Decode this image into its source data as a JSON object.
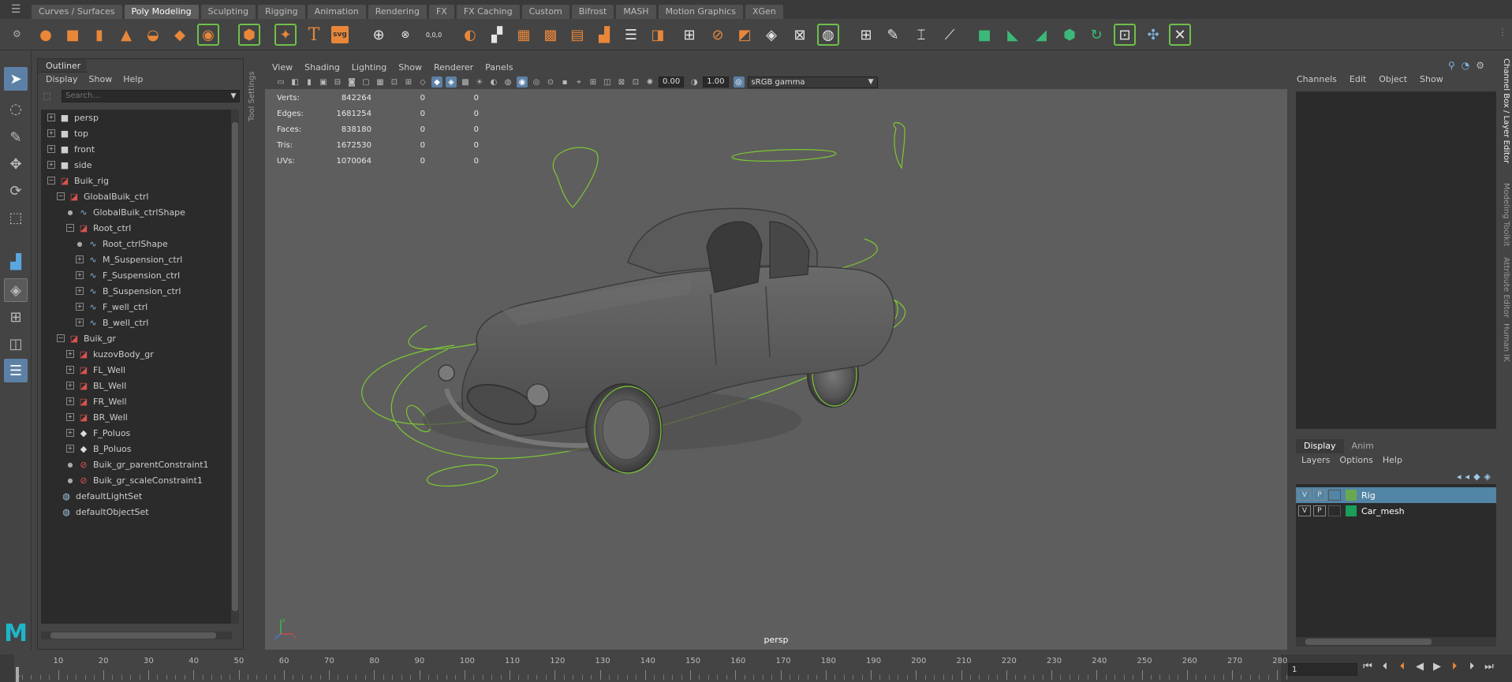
{
  "shelf": {
    "tabs": [
      "Curves / Surfaces",
      "Poly Modeling",
      "Sculpting",
      "Rigging",
      "Animation",
      "Rendering",
      "FX",
      "FX Caching",
      "Custom",
      "Bifrost",
      "MASH",
      "Motion Graphics",
      "XGen"
    ],
    "active_tab": "Poly Modeling",
    "svg_icon_label": "svg",
    "text_icon_label": "T",
    "coord_icon_label": "0,0,0"
  },
  "outliner": {
    "title": "Outliner",
    "menu": [
      "Display",
      "Show",
      "Help"
    ],
    "search_placeholder": "Search...",
    "items": [
      {
        "label": "persp",
        "icon": "camera-icon"
      },
      {
        "label": "top",
        "icon": "camera-icon"
      },
      {
        "label": "front",
        "icon": "camera-icon"
      },
      {
        "label": "side",
        "icon": "camera-icon"
      },
      {
        "label": "Buik_rig",
        "icon": "group-icon"
      },
      {
        "label": "GlobalBuik_ctrl",
        "icon": "group-icon"
      },
      {
        "label": "GlobalBuik_ctrlShape",
        "icon": "curve-icon"
      },
      {
        "label": "Root_ctrl",
        "icon": "group-icon"
      },
      {
        "label": "Root_ctrlShape",
        "icon": "curve-icon"
      },
      {
        "label": "M_Suspension_ctrl",
        "icon": "curve-icon"
      },
      {
        "label": "F_Suspension_ctrl",
        "icon": "curve-icon"
      },
      {
        "label": "B_Suspension_ctrl",
        "icon": "curve-icon"
      },
      {
        "label": "F_well_ctrl",
        "icon": "curve-icon"
      },
      {
        "label": "B_well_ctrl",
        "icon": "curve-icon"
      },
      {
        "label": "Buik_gr",
        "icon": "group-icon"
      },
      {
        "label": "kuzovBody_gr",
        "icon": "group-icon"
      },
      {
        "label": "FL_Well",
        "icon": "group-icon"
      },
      {
        "label": "BL_Well",
        "icon": "group-icon"
      },
      {
        "label": "FR_Well",
        "icon": "group-icon"
      },
      {
        "label": "BR_Well",
        "icon": "group-icon"
      },
      {
        "label": "F_Poluos",
        "icon": "mesh-icon"
      },
      {
        "label": "B_Poluos",
        "icon": "mesh-icon"
      },
      {
        "label": "Buik_gr_parentConstraint1",
        "icon": "constraint-icon"
      },
      {
        "label": "Buik_gr_scaleConstraint1",
        "icon": "constraint-icon"
      },
      {
        "label": "defaultLightSet",
        "icon": "set-icon"
      },
      {
        "label": "defaultObjectSet",
        "icon": "set-icon"
      }
    ]
  },
  "tool_settings_label": "Tool Settings",
  "viewport": {
    "menu": [
      "View",
      "Shading",
      "Lighting",
      "Show",
      "Renderer",
      "Panels"
    ],
    "exposure": "0.00",
    "gamma": "1.00",
    "color_space": "sRGB gamma",
    "camera": "persp",
    "hud": [
      {
        "label": "Verts:",
        "value": "842264",
        "sel": "0",
        "extra": "0"
      },
      {
        "label": "Edges:",
        "value": "1681254",
        "sel": "0",
        "extra": "0"
      },
      {
        "label": "Faces:",
        "value": "838180",
        "sel": "0",
        "extra": "0"
      },
      {
        "label": "Tris:",
        "value": "1672530",
        "sel": "0",
        "extra": "0"
      },
      {
        "label": "UVs:",
        "value": "1070064",
        "sel": "0",
        "extra": "0"
      }
    ],
    "axis": {
      "x": "x",
      "y": "y",
      "z": "z"
    }
  },
  "channel_box": {
    "menu": [
      "Channels",
      "Edit",
      "Object",
      "Show"
    ]
  },
  "layer_editor": {
    "tabs": [
      "Display",
      "Anim"
    ],
    "active_tab": "Display",
    "menu": [
      "Layers",
      "Options",
      "Help"
    ],
    "layers": [
      {
        "v": "V",
        "p": "P",
        "name": "Rig",
        "color": "#6aa84f",
        "selected": true
      },
      {
        "v": "V",
        "p": "P",
        "name": "Car_mesh",
        "color": "#1a9e5a",
        "selected": false
      }
    ]
  },
  "side_tabs": [
    "Channel Box / Layer Editor",
    "Modeling Toolkit",
    "Attribute Editor",
    "Human IK"
  ],
  "timeline": {
    "start_label": "1",
    "labels": [
      "10",
      "20",
      "30",
      "40",
      "50",
      "60",
      "70",
      "80",
      "90",
      "100",
      "110",
      "120",
      "130",
      "140",
      "150",
      "160",
      "170",
      "180",
      "190",
      "200",
      "210",
      "220",
      "230",
      "240",
      "250",
      "260",
      "270",
      "280"
    ],
    "current_frame": "1"
  },
  "colors": {
    "accent_blue": "#5d81a6",
    "rig_curve_green": "#7cc832",
    "shelf_orange": "#e8873a"
  }
}
